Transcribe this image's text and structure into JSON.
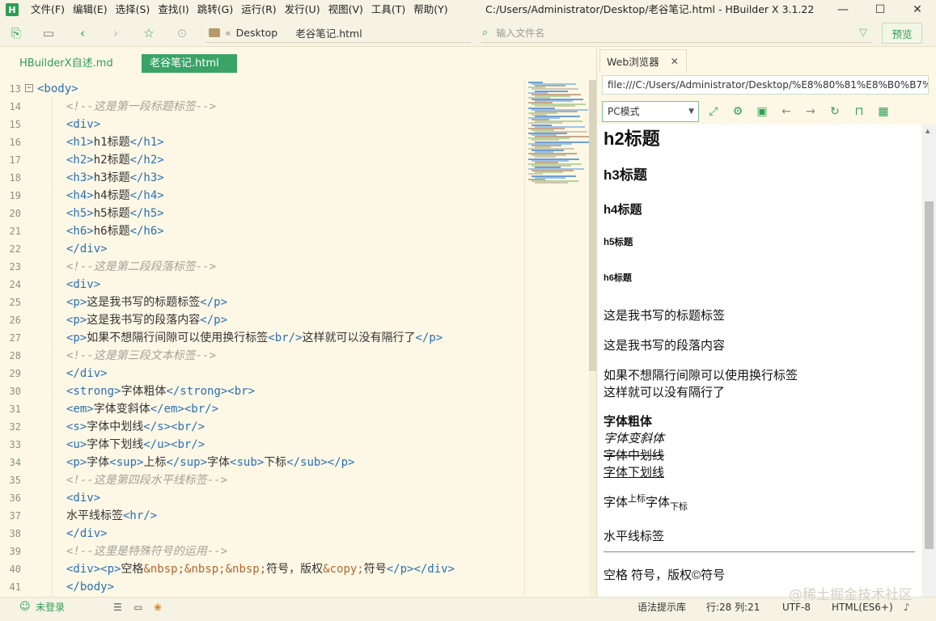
{
  "app": {
    "logo_letter": "H",
    "window_title": "C:/Users/Administrator/Desktop/老谷笔记.html - HBuilder X 3.1.22"
  },
  "menus": [
    "文件(F)",
    "编辑(E)",
    "选择(S)",
    "查找(I)",
    "跳转(G)",
    "运行(R)",
    "发行(U)",
    "视图(V)",
    "工具(T)",
    "帮助(Y)"
  ],
  "toolbar": {
    "breadcrumb": [
      "Desktop",
      "老谷笔记.html"
    ],
    "breadcrumb_sep": "«",
    "file_search_placeholder": "输入文件名",
    "preview_label": "预览"
  },
  "editor_tabs": [
    {
      "label": "HBuilderX自述.md",
      "active": false
    },
    {
      "label": "老谷笔记.html",
      "active": true
    }
  ],
  "editor": {
    "lines": [
      {
        "num": "13",
        "text": "<body>",
        "kind": "tag",
        "indent": false,
        "fold": "⊟"
      },
      {
        "num": "14",
        "text": "<!--这是第一段标题标签-->",
        "kind": "comment",
        "indent": true
      },
      {
        "num": "15",
        "text": "<div>",
        "kind": "tag",
        "indent": true
      },
      {
        "num": "16",
        "kind": "mixed",
        "indent": true,
        "parts": [
          [
            "tag",
            "<h1>"
          ],
          [
            "txt",
            "h1标题"
          ],
          [
            "tag",
            "</h1>"
          ]
        ]
      },
      {
        "num": "17",
        "kind": "mixed",
        "indent": true,
        "parts": [
          [
            "tag",
            "<h2>"
          ],
          [
            "txt",
            "h2标题"
          ],
          [
            "tag",
            "</h2>"
          ]
        ]
      },
      {
        "num": "18",
        "kind": "mixed",
        "indent": true,
        "parts": [
          [
            "tag",
            "<h3>"
          ],
          [
            "txt",
            "h3标题"
          ],
          [
            "tag",
            "</h3>"
          ]
        ]
      },
      {
        "num": "19",
        "kind": "mixed",
        "indent": true,
        "parts": [
          [
            "tag",
            "<h4>"
          ],
          [
            "txt",
            "h4标题"
          ],
          [
            "tag",
            "</h4>"
          ]
        ]
      },
      {
        "num": "20",
        "kind": "mixed",
        "indent": true,
        "parts": [
          [
            "tag",
            "<h5>"
          ],
          [
            "txt",
            "h5标题"
          ],
          [
            "tag",
            "</h5>"
          ]
        ]
      },
      {
        "num": "21",
        "kind": "mixed",
        "indent": true,
        "parts": [
          [
            "tag",
            "<h6>"
          ],
          [
            "txt",
            "h6标题"
          ],
          [
            "tag",
            "</h6>"
          ]
        ]
      },
      {
        "num": "22",
        "text": "</div>",
        "kind": "tag",
        "indent": true
      },
      {
        "num": "23",
        "text": "<!--这是第二段段落标签-->",
        "kind": "comment",
        "indent": true
      },
      {
        "num": "24",
        "text": "<div>",
        "kind": "tag",
        "indent": true
      },
      {
        "num": "25",
        "kind": "mixed",
        "indent": true,
        "parts": [
          [
            "tag",
            "<p>"
          ],
          [
            "txt",
            "这是我书写的标题标签"
          ],
          [
            "tag",
            "</p>"
          ]
        ]
      },
      {
        "num": "26",
        "kind": "mixed",
        "indent": true,
        "parts": [
          [
            "tag",
            "<p>"
          ],
          [
            "txt",
            "这是我书写的段落内容"
          ],
          [
            "tag",
            "</p>"
          ]
        ]
      },
      {
        "num": "27",
        "kind": "mixed",
        "indent": true,
        "parts": [
          [
            "tag",
            "<p>"
          ],
          [
            "txt",
            "如果不想隔行间隙可以使用换行标签"
          ],
          [
            "tag",
            "<br/>"
          ],
          [
            "txt",
            "这样就可以没有隔行了"
          ],
          [
            "tag",
            "</p>"
          ]
        ]
      },
      {
        "num": "28",
        "text": "<!--这是第三段文本标签-->",
        "kind": "comment",
        "indent": true
      },
      {
        "num": "29",
        "text": "</div>",
        "kind": "tag",
        "indent": true
      },
      {
        "num": "30",
        "kind": "mixed",
        "indent": true,
        "parts": [
          [
            "tag",
            "<strong>"
          ],
          [
            "txt",
            "字体粗体"
          ],
          [
            "tag",
            "</strong><br>"
          ]
        ]
      },
      {
        "num": "31",
        "kind": "mixed",
        "indent": true,
        "parts": [
          [
            "tag",
            "<em>"
          ],
          [
            "txt",
            "字体变斜体"
          ],
          [
            "tag",
            "</em><br/>"
          ]
        ]
      },
      {
        "num": "32",
        "kind": "mixed",
        "indent": true,
        "parts": [
          [
            "tag",
            "<s>"
          ],
          [
            "txt",
            "字体中划线"
          ],
          [
            "tag",
            "</s><br/>"
          ]
        ]
      },
      {
        "num": "33",
        "kind": "mixed",
        "indent": true,
        "parts": [
          [
            "tag",
            "<u>"
          ],
          [
            "txt",
            "字体下划线"
          ],
          [
            "tag",
            "</u><br/>"
          ]
        ]
      },
      {
        "num": "34",
        "kind": "mixed",
        "indent": true,
        "parts": [
          [
            "tag",
            "<p>"
          ],
          [
            "txt",
            "字体"
          ],
          [
            "tag",
            "<sup>"
          ],
          [
            "txt",
            "上标"
          ],
          [
            "tag",
            "</sup>"
          ],
          [
            "txt",
            "字体"
          ],
          [
            "tag",
            "<sub>"
          ],
          [
            "txt",
            "下标"
          ],
          [
            "tag",
            "</sub></p>"
          ]
        ]
      },
      {
        "num": "35",
        "text": "<!--这是第四段水平线标签-->",
        "kind": "comment",
        "indent": true
      },
      {
        "num": "36",
        "text": "<div>",
        "kind": "tag",
        "indent": true
      },
      {
        "num": "37",
        "kind": "mixed",
        "indent": true,
        "parts": [
          [
            "txt",
            "水平线标签"
          ],
          [
            "tag",
            "<hr/>"
          ]
        ]
      },
      {
        "num": "38",
        "text": "</div>",
        "kind": "tag",
        "indent": true
      },
      {
        "num": "39",
        "text": "<!--这里是特殊符号的运用-->",
        "kind": "comment",
        "indent": true
      },
      {
        "num": "40",
        "kind": "mixed",
        "indent": true,
        "parts": [
          [
            "tag",
            "<div><p>"
          ],
          [
            "txt",
            "空格"
          ],
          [
            "ent",
            "&nbsp;&nbsp;&nbsp;"
          ],
          [
            "txt",
            "符号，版权"
          ],
          [
            "ent",
            "&copy;"
          ],
          [
            "txt",
            "符号"
          ],
          [
            "tag",
            "</p></div>"
          ]
        ]
      },
      {
        "num": "41",
        "text": "</body>",
        "kind": "tag",
        "indent": true
      }
    ]
  },
  "browser": {
    "tab_label": "Web浏览器",
    "tab_close": "✕",
    "url": "file:///C:/Users/Administrator/Desktop/%E8%80%81%E8%B0%B7%E",
    "mode": "PC模式",
    "preview": {
      "h2": "h2标题",
      "h3": "h3标题",
      "h4": "h4标题",
      "h5": "h5标题",
      "h6": "h6标题",
      "p1": "这是我书写的标题标签",
      "p2": "这是我书写的段落内容",
      "p3_line1": "如果不想隔行间隙可以使用换行标签",
      "p3_line2": "这样就可以没有隔行了",
      "strong": "字体粗体",
      "em": "字体变斜体",
      "s": "字体中划线",
      "u": "字体下划线",
      "supsub_a": "字体",
      "sup": "上标",
      "supsub_b": "字体",
      "sub": "下标",
      "hr_text": "水平线标签",
      "special": "空格   符号，版权©符号"
    }
  },
  "statusbar": {
    "login": "未登录",
    "syntax_hint": "语法提示库",
    "position": "行:28  列:21",
    "encoding": "UTF-8",
    "language": "HTML(ES6+)"
  },
  "watermark": "@稀土掘金技术社区",
  "colors": {
    "accent": "#2e9e54",
    "tag": "#2b6fb5",
    "comment": "#a2a29a",
    "entity": "#b5652f",
    "background": "#fdf8e6"
  }
}
